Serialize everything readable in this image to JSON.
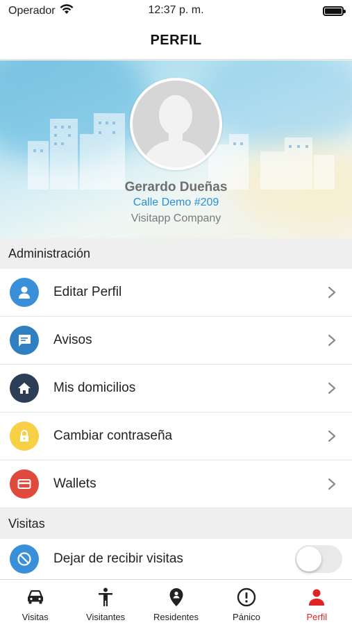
{
  "status_bar": {
    "carrier": "Operador",
    "time": "12:37 p. m."
  },
  "nav": {
    "title": "PERFIL"
  },
  "profile": {
    "name": "Gerardo Dueñas",
    "address": "Calle Demo #209",
    "company": "Visitapp Company"
  },
  "sections": {
    "admin": {
      "title": "Administración",
      "items": [
        {
          "label": "Editar Perfil",
          "icon": "person-icon",
          "color": "#3a8fd9"
        },
        {
          "label": "Avisos",
          "icon": "message-icon",
          "color": "#2f7fc1"
        },
        {
          "label": "Mis domicilios",
          "icon": "home-icon",
          "color": "#2c3e55"
        },
        {
          "label": "Cambiar contraseña",
          "icon": "lock-icon",
          "color": "#f7d046"
        },
        {
          "label": "Wallets",
          "icon": "card-icon",
          "color": "#e04a3c"
        }
      ]
    },
    "visits": {
      "title": "Visitas",
      "items": [
        {
          "label": "Dejar de recibir visitas",
          "icon": "block-icon",
          "color": "#3a8fd9",
          "toggle_on": false
        }
      ]
    }
  },
  "tabs": [
    {
      "label": "Visitas",
      "icon": "car-icon",
      "active": false
    },
    {
      "label": "Visitantes",
      "icon": "person-standing-icon",
      "active": false
    },
    {
      "label": "Residentes",
      "icon": "location-pin-icon",
      "active": false
    },
    {
      "label": "Pánico",
      "icon": "alert-icon",
      "active": false
    },
    {
      "label": "Perfil",
      "icon": "person-icon",
      "active": true
    }
  ],
  "colors": {
    "accent": "#e02424",
    "link": "#2b8fd6"
  }
}
